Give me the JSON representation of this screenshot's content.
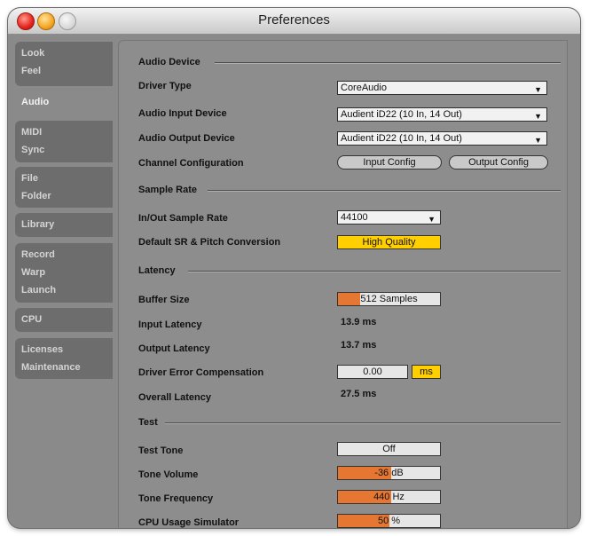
{
  "window": {
    "title": "Preferences"
  },
  "sidebar": {
    "tabs": [
      {
        "lines": [
          "Look",
          "Feel"
        ]
      },
      {
        "lines": [
          "Audio"
        ]
      },
      {
        "lines": [
          "MIDI",
          "Sync"
        ]
      },
      {
        "lines": [
          "File",
          "Folder"
        ]
      },
      {
        "lines": [
          "Library"
        ]
      },
      {
        "lines": [
          "Record",
          "Warp",
          "Launch"
        ]
      },
      {
        "lines": [
          "CPU"
        ]
      },
      {
        "lines": [
          "Licenses",
          "Maintenance"
        ]
      }
    ],
    "active_tab": "Audio"
  },
  "audio_device": {
    "heading": "Audio Device",
    "driver_type": {
      "label": "Driver Type",
      "value": "CoreAudio"
    },
    "input_device": {
      "label": "Audio Input Device",
      "value": "Audient iD22 (10 In, 14 Out)"
    },
    "output_device": {
      "label": "Audio Output Device",
      "value": "Audient iD22 (10 In, 14 Out)"
    },
    "channel_config": {
      "label": "Channel Configuration",
      "input_button": "Input Config",
      "output_button": "Output Config"
    }
  },
  "sample_rate": {
    "heading": "Sample Rate",
    "in_out": {
      "label": "In/Out Sample Rate",
      "value": "44100"
    },
    "conversion": {
      "label": "Default SR & Pitch Conversion",
      "value": "High Quality"
    }
  },
  "latency": {
    "heading": "Latency",
    "buffer_size": {
      "label": "Buffer Size",
      "value_prefix": "5",
      "value_suffix": "12 Samples",
      "fill_fraction": 0.22
    },
    "input_latency": {
      "label": "Input Latency",
      "value": "13.9 ms"
    },
    "output_latency": {
      "label": "Output Latency",
      "value": "13.7 ms"
    },
    "driver_error": {
      "label": "Driver Error Compensation",
      "value": "0.00",
      "unit": "ms"
    },
    "overall": {
      "label": "Overall Latency",
      "value": "27.5 ms"
    }
  },
  "test": {
    "heading": "Test",
    "test_tone": {
      "label": "Test Tone",
      "value": "Off"
    },
    "tone_volume": {
      "label": "Tone Volume",
      "value_num": "-36",
      "value_unit": "dB",
      "fill_fraction": 0.52
    },
    "tone_frequency": {
      "label": "Tone Frequency",
      "value_num": "440",
      "value_unit": "Hz",
      "fill_fraction": 0.52
    },
    "cpu_sim": {
      "label": "CPU Usage Simulator",
      "value": "50 %",
      "fill_fraction": 0.5
    }
  },
  "colors": {
    "accent_orange": "#e57733",
    "highlight_yellow": "#ffcf00",
    "panel_gray": "#8d8d8d"
  }
}
